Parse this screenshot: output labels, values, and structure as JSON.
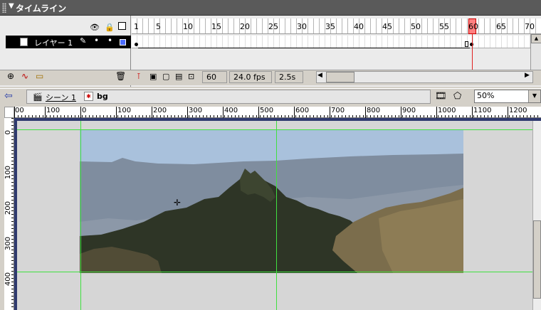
{
  "timeline": {
    "title": "タイムライン",
    "layer_name": "レイヤー 1",
    "frame_numbers": [
      "1",
      "5",
      "10",
      "15",
      "20",
      "25",
      "30",
      "35",
      "40",
      "45",
      "50",
      "55",
      "60",
      "65",
      "70"
    ],
    "current_frame": "60",
    "frame_rate": "24.0 fps",
    "elapsed_time": "2.5s"
  },
  "scene_bar": {
    "scene_label": "シーン 1",
    "symbol_label": "bg",
    "zoom": "50%"
  },
  "ruler": {
    "h_labels": [
      "00",
      "100",
      "0",
      "100",
      "200",
      "300",
      "400",
      "500",
      "600",
      "700",
      "800",
      "900",
      "1000",
      "1100",
      "1200"
    ],
    "v_labels": [
      "0",
      "100",
      "200",
      "300",
      "400"
    ]
  },
  "colors": {
    "layer_outline": "#4c6cff",
    "guide": "#40e040",
    "playhead": "#e02020",
    "stage_frame": "#2f3a6e"
  }
}
